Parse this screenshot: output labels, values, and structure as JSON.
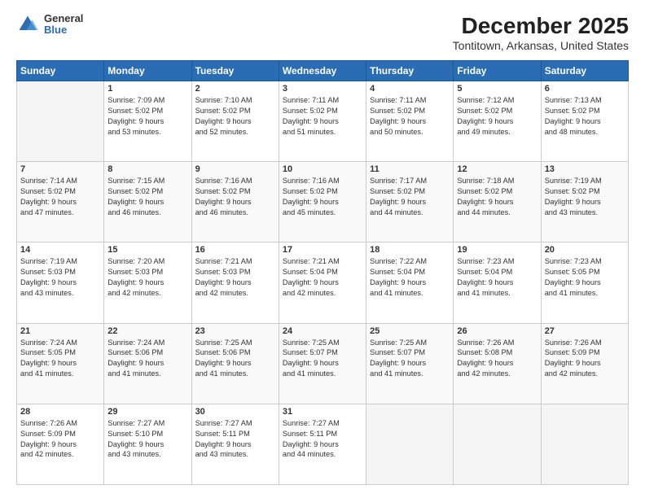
{
  "header": {
    "logo": {
      "general": "General",
      "blue": "Blue"
    },
    "title": "December 2025",
    "subtitle": "Tontitown, Arkansas, United States"
  },
  "calendar": {
    "days_of_week": [
      "Sunday",
      "Monday",
      "Tuesday",
      "Wednesday",
      "Thursday",
      "Friday",
      "Saturday"
    ],
    "weeks": [
      [
        {
          "day": "",
          "info": ""
        },
        {
          "day": "1",
          "info": "Sunrise: 7:09 AM\nSunset: 5:02 PM\nDaylight: 9 hours\nand 53 minutes."
        },
        {
          "day": "2",
          "info": "Sunrise: 7:10 AM\nSunset: 5:02 PM\nDaylight: 9 hours\nand 52 minutes."
        },
        {
          "day": "3",
          "info": "Sunrise: 7:11 AM\nSunset: 5:02 PM\nDaylight: 9 hours\nand 51 minutes."
        },
        {
          "day": "4",
          "info": "Sunrise: 7:11 AM\nSunset: 5:02 PM\nDaylight: 9 hours\nand 50 minutes."
        },
        {
          "day": "5",
          "info": "Sunrise: 7:12 AM\nSunset: 5:02 PM\nDaylight: 9 hours\nand 49 minutes."
        },
        {
          "day": "6",
          "info": "Sunrise: 7:13 AM\nSunset: 5:02 PM\nDaylight: 9 hours\nand 48 minutes."
        }
      ],
      [
        {
          "day": "7",
          "info": "Sunrise: 7:14 AM\nSunset: 5:02 PM\nDaylight: 9 hours\nand 47 minutes."
        },
        {
          "day": "8",
          "info": "Sunrise: 7:15 AM\nSunset: 5:02 PM\nDaylight: 9 hours\nand 46 minutes."
        },
        {
          "day": "9",
          "info": "Sunrise: 7:16 AM\nSunset: 5:02 PM\nDaylight: 9 hours\nand 46 minutes."
        },
        {
          "day": "10",
          "info": "Sunrise: 7:16 AM\nSunset: 5:02 PM\nDaylight: 9 hours\nand 45 minutes."
        },
        {
          "day": "11",
          "info": "Sunrise: 7:17 AM\nSunset: 5:02 PM\nDaylight: 9 hours\nand 44 minutes."
        },
        {
          "day": "12",
          "info": "Sunrise: 7:18 AM\nSunset: 5:02 PM\nDaylight: 9 hours\nand 44 minutes."
        },
        {
          "day": "13",
          "info": "Sunrise: 7:19 AM\nSunset: 5:02 PM\nDaylight: 9 hours\nand 43 minutes."
        }
      ],
      [
        {
          "day": "14",
          "info": "Sunrise: 7:19 AM\nSunset: 5:03 PM\nDaylight: 9 hours\nand 43 minutes."
        },
        {
          "day": "15",
          "info": "Sunrise: 7:20 AM\nSunset: 5:03 PM\nDaylight: 9 hours\nand 42 minutes."
        },
        {
          "day": "16",
          "info": "Sunrise: 7:21 AM\nSunset: 5:03 PM\nDaylight: 9 hours\nand 42 minutes."
        },
        {
          "day": "17",
          "info": "Sunrise: 7:21 AM\nSunset: 5:04 PM\nDaylight: 9 hours\nand 42 minutes."
        },
        {
          "day": "18",
          "info": "Sunrise: 7:22 AM\nSunset: 5:04 PM\nDaylight: 9 hours\nand 41 minutes."
        },
        {
          "day": "19",
          "info": "Sunrise: 7:23 AM\nSunset: 5:04 PM\nDaylight: 9 hours\nand 41 minutes."
        },
        {
          "day": "20",
          "info": "Sunrise: 7:23 AM\nSunset: 5:05 PM\nDaylight: 9 hours\nand 41 minutes."
        }
      ],
      [
        {
          "day": "21",
          "info": "Sunrise: 7:24 AM\nSunset: 5:05 PM\nDaylight: 9 hours\nand 41 minutes."
        },
        {
          "day": "22",
          "info": "Sunrise: 7:24 AM\nSunset: 5:06 PM\nDaylight: 9 hours\nand 41 minutes."
        },
        {
          "day": "23",
          "info": "Sunrise: 7:25 AM\nSunset: 5:06 PM\nDaylight: 9 hours\nand 41 minutes."
        },
        {
          "day": "24",
          "info": "Sunrise: 7:25 AM\nSunset: 5:07 PM\nDaylight: 9 hours\nand 41 minutes."
        },
        {
          "day": "25",
          "info": "Sunrise: 7:25 AM\nSunset: 5:07 PM\nDaylight: 9 hours\nand 41 minutes."
        },
        {
          "day": "26",
          "info": "Sunrise: 7:26 AM\nSunset: 5:08 PM\nDaylight: 9 hours\nand 42 minutes."
        },
        {
          "day": "27",
          "info": "Sunrise: 7:26 AM\nSunset: 5:09 PM\nDaylight: 9 hours\nand 42 minutes."
        }
      ],
      [
        {
          "day": "28",
          "info": "Sunrise: 7:26 AM\nSunset: 5:09 PM\nDaylight: 9 hours\nand 42 minutes."
        },
        {
          "day": "29",
          "info": "Sunrise: 7:27 AM\nSunset: 5:10 PM\nDaylight: 9 hours\nand 43 minutes."
        },
        {
          "day": "30",
          "info": "Sunrise: 7:27 AM\nSunset: 5:11 PM\nDaylight: 9 hours\nand 43 minutes."
        },
        {
          "day": "31",
          "info": "Sunrise: 7:27 AM\nSunset: 5:11 PM\nDaylight: 9 hours\nand 44 minutes."
        },
        {
          "day": "",
          "info": ""
        },
        {
          "day": "",
          "info": ""
        },
        {
          "day": "",
          "info": ""
        }
      ]
    ]
  }
}
